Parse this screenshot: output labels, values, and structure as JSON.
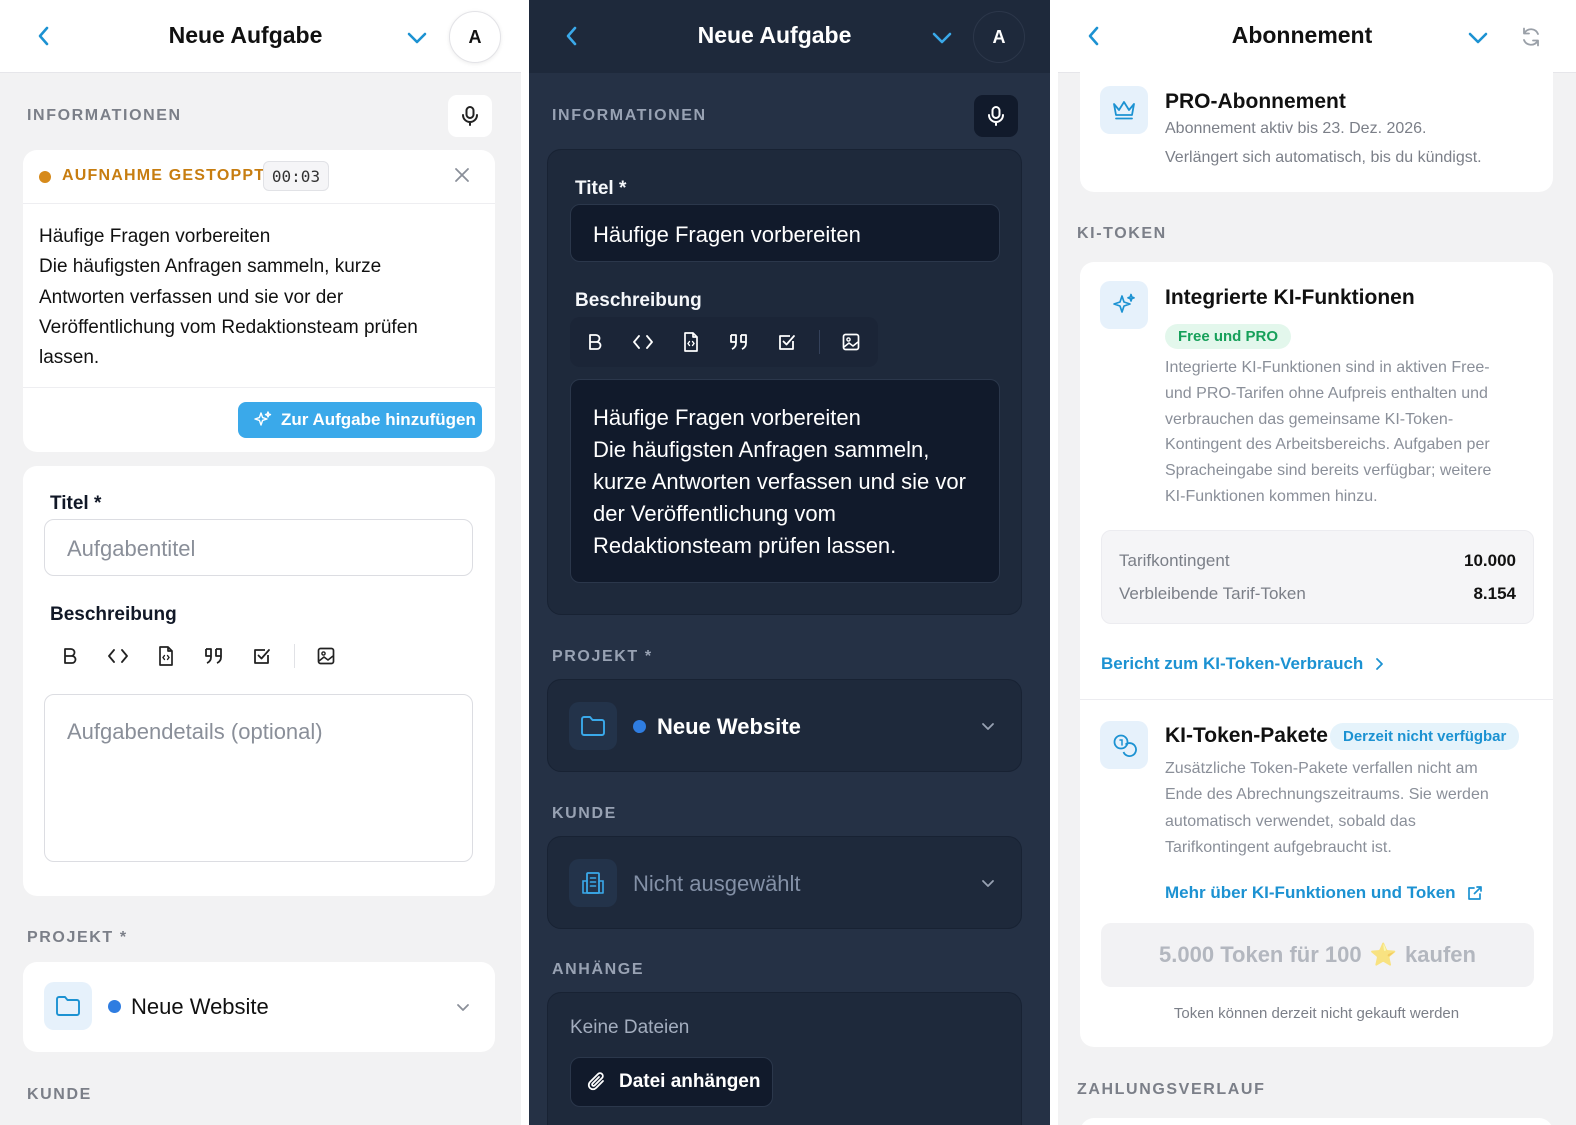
{
  "panel1": {
    "header": {
      "title": "Neue Aufgabe",
      "avatar": "A"
    },
    "section_info": "INFORMATIONEN",
    "recording": {
      "status": "AUFNAHME GESTOPPT",
      "time": "00:03",
      "status_color": "#c77d10"
    },
    "transcript": [
      "Häufige Fragen vorbereiten",
      "Die häufigsten Anfragen sammeln, kurze",
      "Antworten verfassen und sie vor der",
      "Veröffentlichung vom Redaktionsteam prüfen",
      "lassen."
    ],
    "add_button": "Zur Aufgabe hinzufügen",
    "form": {
      "title_label": "Titel *",
      "title_placeholder": "Aufgabentitel",
      "desc_label": "Beschreibung",
      "desc_placeholder": "Aufgabendetails (optional)"
    },
    "section_project": "PROJEKT *",
    "project": {
      "name": "Neue Website",
      "dot_color": "#2f7de1"
    },
    "section_customer": "KUNDE"
  },
  "panel2": {
    "header": {
      "title": "Neue Aufgabe",
      "avatar": "A"
    },
    "section_info": "INFORMATIONEN",
    "form": {
      "title_label": "Titel *",
      "title_value": "Häufige Fragen vorbereiten",
      "desc_label": "Beschreibung",
      "desc_lines": [
        "Häufige Fragen vorbereiten",
        "Die häufigsten Anfragen sammeln,",
        "kurze Antworten verfassen und sie vor",
        "der Veröffentlichung vom",
        "Redaktionsteam prüfen lassen."
      ]
    },
    "section_project": "PROJEKT *",
    "project": {
      "name": "Neue Website",
      "dot_color": "#2f7de1"
    },
    "section_customer": "KUNDE",
    "customer": {
      "placeholder": "Nicht ausgewählt"
    },
    "section_attachments": "ANHÄNGE",
    "attachments": {
      "empty": "Keine Dateien",
      "button": "Datei anhängen"
    }
  },
  "panel3": {
    "header": {
      "title": "Abonnement"
    },
    "pro": {
      "title": "PRO-Abonnement",
      "line1": "Abonnement aktiv bis 23. Dez. 2026.",
      "line2": "Verlängert sich automatisch, bis du kündigst."
    },
    "section_tokens": "KI-TOKEN",
    "ai": {
      "title": "Integrierte KI-Funktionen",
      "badge": "Free und PRO",
      "desc": [
        "Integrierte KI-Funktionen sind in aktiven Free-",
        "und PRO-Tarifen ohne Aufpreis enthalten und",
        "verbrauchen das gemeinsame KI-Token-",
        "Kontingent des Arbeitsbereichs. Aufgaben per",
        "Spracheingabe sind bereits verfügbar; weitere",
        "KI-Funktionen kommen hinzu."
      ],
      "quota_label": "Tarifkontingent",
      "quota_value": "10.000",
      "remaining_label": "Verbleibende Tarif-Token",
      "remaining_value": "8.154",
      "report_link": "Bericht zum KI-Token-Verbrauch"
    },
    "packs": {
      "title": "KI-Token-Pakete",
      "badge": "Derzeit nicht verfügbar",
      "desc": [
        "Zusätzliche Token-Pakete verfallen nicht am",
        "Ende des Abrechnungszeitraums. Sie werden",
        "automatisch verwendet, sobald das",
        "Tarifkontingent aufgebraucht ist."
      ],
      "more_link": "Mehr über KI-Funktionen und Token",
      "buy_before": "5.000 Token für 100",
      "buy_star": "⭐",
      "buy_after": "kaufen",
      "note": "Token können derzeit nicht gekauft werden"
    },
    "section_payments": "ZAHLUNGSVERLAUF"
  },
  "colors": {
    "accent": "#1c92d2",
    "button_blue": "#3aa9ea",
    "dark_bg": "#253145",
    "green_badge_bg": "#e3f7ec",
    "green_badge_text": "#16a05a"
  }
}
